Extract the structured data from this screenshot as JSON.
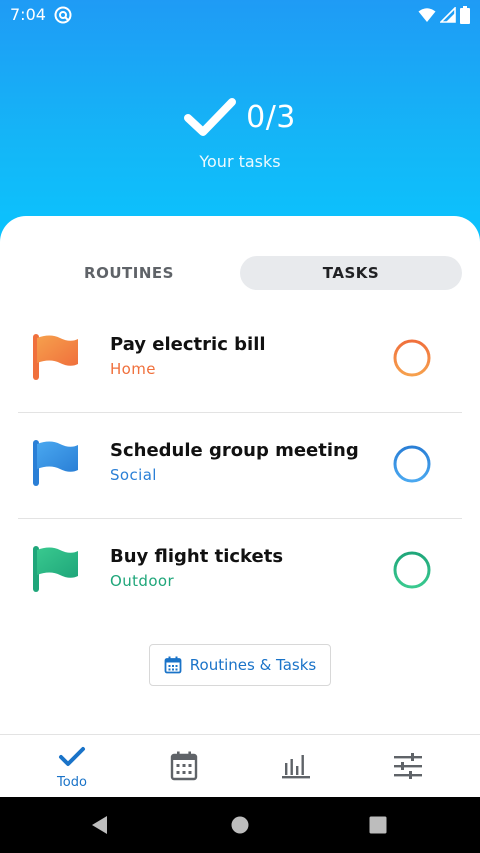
{
  "status_bar": {
    "time": "7:04",
    "icons": [
      "app-notification-icon",
      "wifi-icon",
      "signal-icon",
      "battery-icon"
    ]
  },
  "header": {
    "score": "0/3",
    "subtitle": "Your tasks",
    "gradient_top": "#1f9bf5",
    "gradient_bottom": "#09c6ff"
  },
  "tabs": [
    {
      "label": "ROUTINES",
      "selected": false
    },
    {
      "label": "TASKS",
      "selected": true
    }
  ],
  "tasks": [
    {
      "title": "Pay electric bill",
      "category": "Home",
      "color": "#f0703c",
      "color_light": "#f6a04d",
      "icon": "flag-icon"
    },
    {
      "title": "Schedule group meeting",
      "category": "Social",
      "color": "#2a7fd6",
      "color_light": "#4aa8f0",
      "icon": "flag-icon"
    },
    {
      "title": "Buy flight tickets",
      "category": "Outdoor",
      "color": "#1fa67a",
      "color_light": "#39c98f",
      "icon": "flag-icon"
    }
  ],
  "routines_tasks_button": {
    "label": "Routines & Tasks",
    "icon": "calendar-icon"
  },
  "bottom_nav": [
    {
      "label": "Todo",
      "icon": "check-icon",
      "selected": true
    },
    {
      "label": "",
      "icon": "calendar-icon",
      "selected": false
    },
    {
      "label": "",
      "icon": "bar-chart-icon",
      "selected": false
    },
    {
      "label": "",
      "icon": "sliders-icon",
      "selected": false
    }
  ],
  "system_nav": [
    "back-icon",
    "home-icon",
    "recents-icon"
  ],
  "colors": {
    "accent": "#1a73c8",
    "text": "#111111"
  }
}
